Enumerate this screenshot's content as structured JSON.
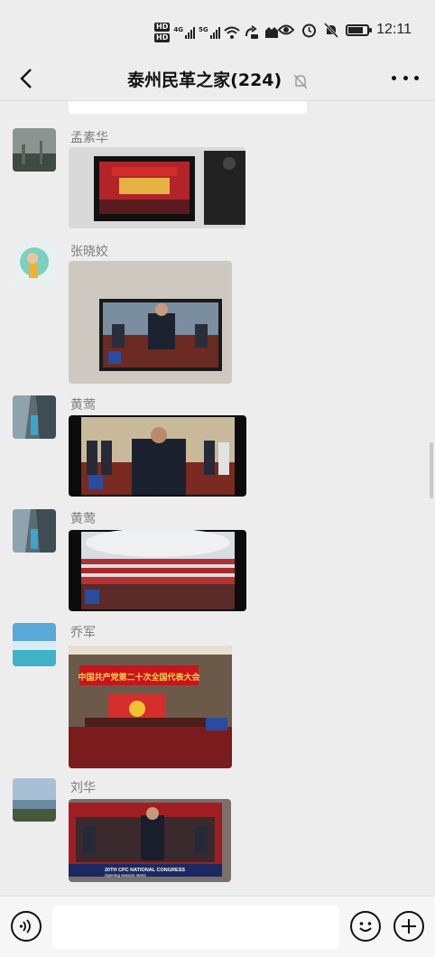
{
  "status_bar": {
    "hd1": "HD",
    "hd2": "HD",
    "net1": "4G",
    "net2": "5G",
    "time": "12:11"
  },
  "header": {
    "title": "泰州民革之家(224)"
  },
  "messages": [
    {
      "sender": "孟素华",
      "image": "tv-broadcast-congress-hall"
    },
    {
      "sender": "张晓姣",
      "image": "tv-broadcast-leader-speech"
    },
    {
      "sender": "黄莺",
      "image": "tv-broadcast-leader-on-stage"
    },
    {
      "sender": "黄莺",
      "image": "tv-broadcast-great-hall-wide"
    },
    {
      "sender": "乔军",
      "image": "tv-broadcast-congress-stage",
      "banner": "中国共产党第二十次全国代表大会"
    },
    {
      "sender": "刘华",
      "image": "tv-broadcast-leaders-seated",
      "caption": "20TH CPC NATIONAL CONGRESS",
      "subcaption": "Opening session starts"
    }
  ],
  "input_bar": {
    "voice_icon": "voice-icon",
    "emoji_icon": "emoji-icon",
    "plus_icon": "plus-icon"
  },
  "colors": {
    "background": "#ededed",
    "bubble": "#ffffff",
    "congress_red": "#c8141e"
  }
}
